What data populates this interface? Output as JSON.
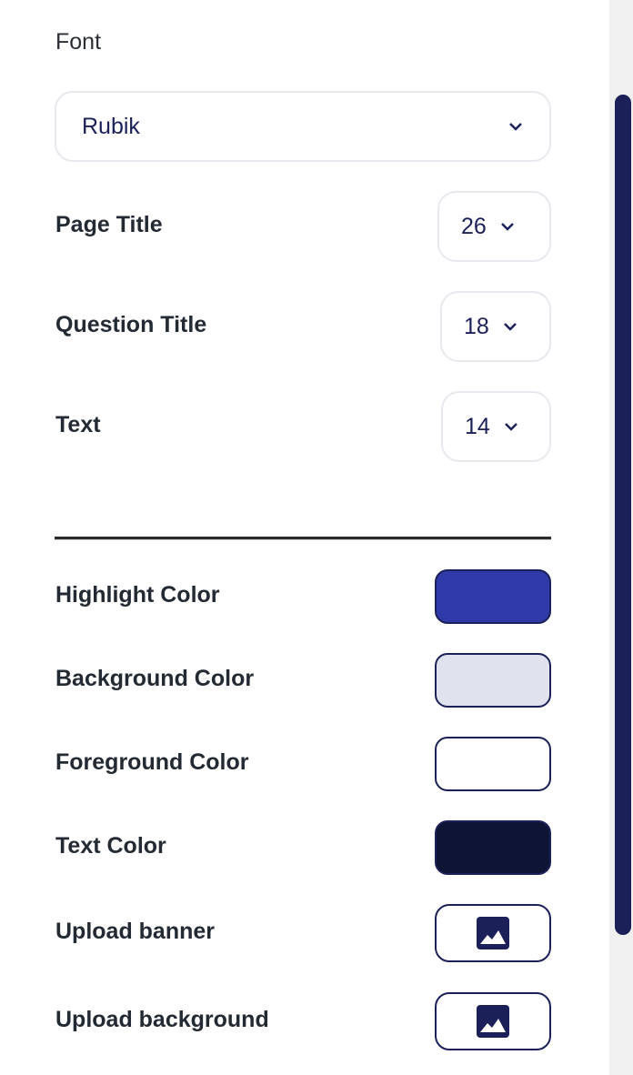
{
  "font": {
    "label": "Font",
    "value": "Rubik"
  },
  "sizes": [
    {
      "label": "Page Title",
      "value": "26"
    },
    {
      "label": "Question Title",
      "value": "18"
    },
    {
      "label": "Text",
      "value": "14"
    }
  ],
  "colors": [
    {
      "label": "Highlight Color",
      "value": "#303ba9"
    },
    {
      "label": "Background Color",
      "value": "#e0e2ee"
    },
    {
      "label": "Foreground Color",
      "value": "#ffffff"
    },
    {
      "label": "Text Color",
      "value": "#0e1433"
    }
  ],
  "uploads": [
    {
      "label": "Upload banner",
      "icon": "image-icon"
    },
    {
      "label": "Upload background",
      "icon": "image-icon"
    }
  ]
}
